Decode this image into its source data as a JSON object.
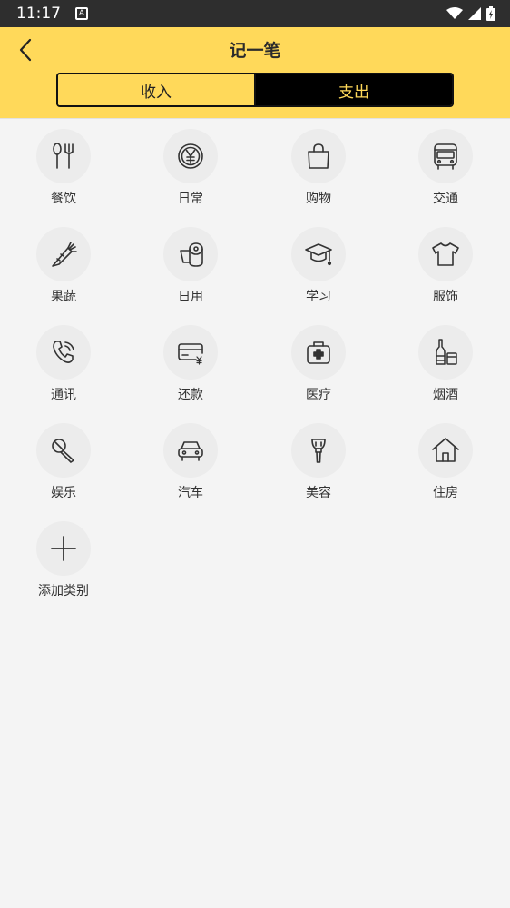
{
  "status_bar": {
    "time": "11:17",
    "notification_icon": "a-icon"
  },
  "header": {
    "title": "记一笔",
    "back_icon": "chevron-left-icon"
  },
  "tabs": {
    "income": "收入",
    "expense": "支出",
    "selected": "expense"
  },
  "colors": {
    "accent": "#ffd95a",
    "dark": "#000000",
    "background": "#f4f4f4"
  },
  "categories": [
    {
      "label": "餐饮",
      "icon": "utensils-icon"
    },
    {
      "label": "日常",
      "icon": "yen-coin-icon"
    },
    {
      "label": "购物",
      "icon": "shopping-bag-icon"
    },
    {
      "label": "交通",
      "icon": "bus-icon"
    },
    {
      "label": "果蔬",
      "icon": "carrot-icon"
    },
    {
      "label": "日用",
      "icon": "tissue-roll-icon"
    },
    {
      "label": "学习",
      "icon": "graduation-cap-icon"
    },
    {
      "label": "服饰",
      "icon": "tshirt-icon"
    },
    {
      "label": "通讯",
      "icon": "phone-icon"
    },
    {
      "label": "还款",
      "icon": "credit-card-icon"
    },
    {
      "label": "医疗",
      "icon": "medical-kit-icon"
    },
    {
      "label": "烟酒",
      "icon": "bottle-icon"
    },
    {
      "label": "娱乐",
      "icon": "microphone-icon"
    },
    {
      "label": "汽车",
      "icon": "car-icon"
    },
    {
      "label": "美容",
      "icon": "makeup-brush-icon"
    },
    {
      "label": "住房",
      "icon": "house-icon"
    },
    {
      "label": "添加类别",
      "icon": "plus-icon"
    }
  ]
}
